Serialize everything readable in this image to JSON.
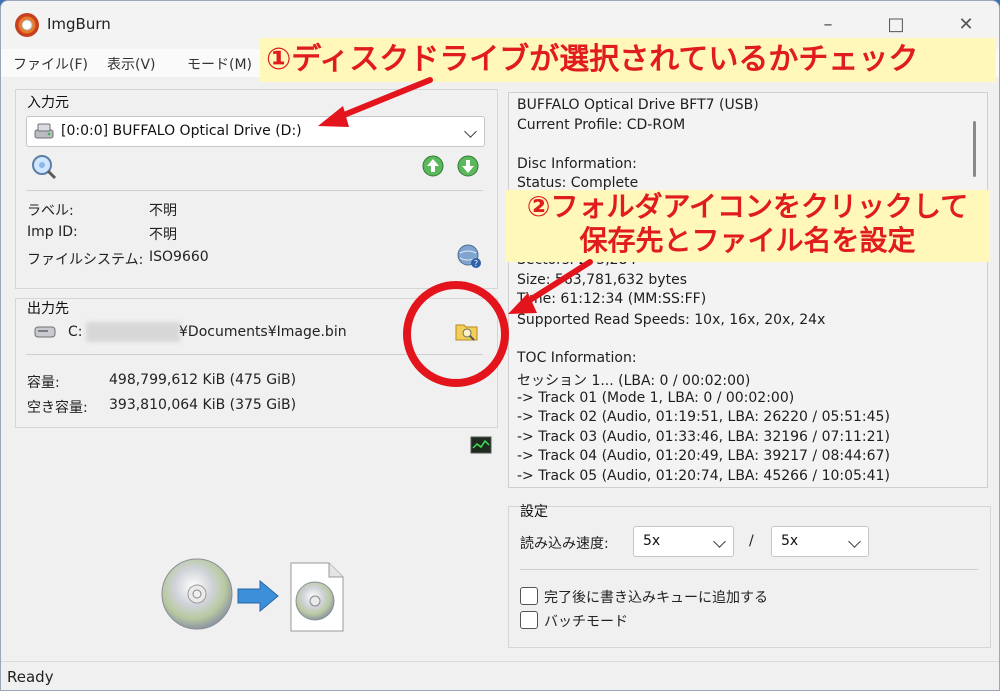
{
  "window": {
    "title": "ImgBurn"
  },
  "menu": [
    "ファイル(F)",
    "表示(V)",
    "モード(M)"
  ],
  "source": {
    "group_label": "入力元",
    "drive": "[0:0:0] BUFFALO Optical Drive (D:)",
    "fields": [
      {
        "label": "ラベル:",
        "value": "不明"
      },
      {
        "label": "Imp ID:",
        "value": "不明"
      },
      {
        "label": "ファイルシステム:",
        "value": "ISO9660"
      }
    ]
  },
  "destination": {
    "group_label": "出力先",
    "path_prefix": "C:",
    "path_suffix": "¥Documents¥Image.bin",
    "capacity": [
      {
        "label": "容量:",
        "value": "498,799,612 KiB  (475 GiB)"
      },
      {
        "label": "空き容量:",
        "value": "393,810,064 KiB  (375 GiB)"
      }
    ]
  },
  "info": [
    "BUFFALO Optical Drive BFT7 (USB)",
    "Current Profile: CD-ROM",
    "",
    "Disc Information:",
    "Status: Complete",
    "",
    "",
    "",
    "Sectors: 275,284",
    "Size: 563,781,632 bytes",
    "Time: 61:12:34 (MM:SS:FF)",
    "Supported Read Speeds: 10x, 16x, 20x, 24x",
    "",
    "TOC Information:",
    "セッション 1... (LBA: 0 / 00:02:00)",
    "-> Track 01  (Mode 1, LBA: 0 / 00:02:00)",
    "-> Track 02  (Audio, 01:19:51, LBA: 26220 / 05:51:45)",
    "-> Track 03  (Audio, 01:33:46, LBA: 32196 / 07:11:21)",
    "-> Track 04  (Audio, 01:20:49, LBA: 39217 / 08:44:67)",
    "-> Track 05  (Audio, 01:20:74, LBA: 45266 / 10:05:41)"
  ],
  "settings": {
    "group_label": "設定",
    "read_speed_label": "読み込み速度:",
    "speed_1": "5x",
    "speed_sep": "/",
    "speed_2": "5x",
    "checkbox_1": "完了後に書き込みキューに追加する",
    "checkbox_2": "バッチモード"
  },
  "status": {
    "text": "Ready"
  },
  "callouts": {
    "c1": "①ディスクドライブが選択されているかチェック",
    "c2_line1": "②フォルダアイコンをクリックして",
    "c2_line2": "保存先とファイル名を設定"
  },
  "colors": {
    "callout_text": "#e11c1c",
    "callout_bg": "#fff8b8",
    "annotation_red": "#e3141b"
  }
}
